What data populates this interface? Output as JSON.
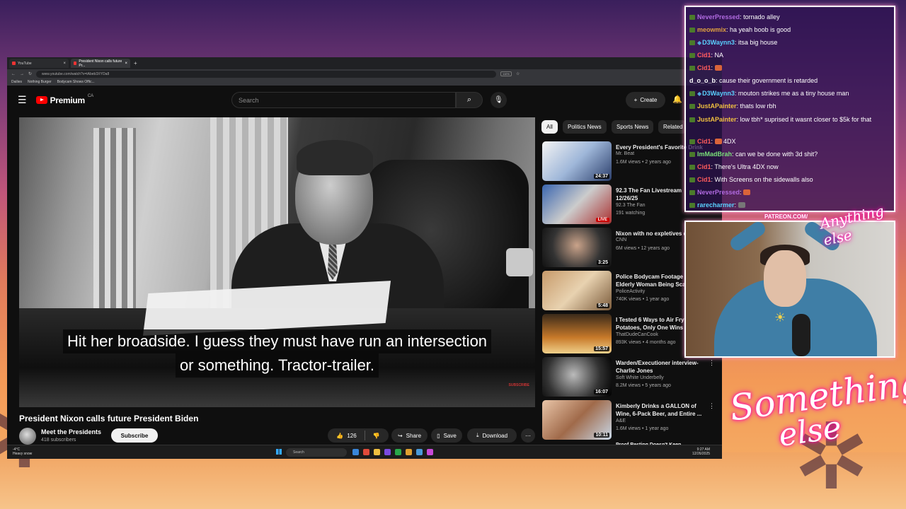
{
  "browser": {
    "tabs": [
      {
        "label": "YouTube"
      },
      {
        "label": "President Nixon calls future Pr..."
      }
    ],
    "url": "www.youtube.com/watch?v=tAbeb3XYOa8",
    "zoom": "110%",
    "bookmarks": [
      "Dailies",
      "Nothing Burger",
      "Bodycam Shows Offic..."
    ]
  },
  "youtube": {
    "logo": "Premium",
    "region": "CA",
    "search_placeholder": "Search",
    "create_label": "Create",
    "caption_line1": "Hit her broadside. I guess they must have run an intersection",
    "caption_line2": "or something. Tractor-trailer.",
    "watermark": "SUBSCRIBE",
    "video_title": "President Nixon calls future President Biden",
    "channel": "Meet the Presidents",
    "subscribers": "418 subscribers",
    "subscribe_label": "Subscribe",
    "likes": "126",
    "share_label": "Share",
    "save_label": "Save",
    "download_label": "Download",
    "chips": [
      "All",
      "Politics News",
      "Sports News",
      "Related"
    ],
    "recommendations": [
      {
        "title": "Every President's Favorite Drink",
        "channel": "Mr. Beat",
        "meta": "1.6M views • 2 years ago",
        "duration": "24:37"
      },
      {
        "title": "92.3 The Fan Livestream 12/26/25",
        "channel": "92.3 The Fan",
        "meta": "191 watching",
        "badge": "LIVE"
      },
      {
        "title": "Nixon with no expletives d...",
        "channel": "CNN",
        "meta": "6M views • 12 years ago",
        "duration": "3:25"
      },
      {
        "title": "Police Bodycam Footage Elderly Woman Being Sca...",
        "channel": "PoliceActivity",
        "meta": "740K views • 1 year ago",
        "duration": "5:48"
      },
      {
        "title": "I Tested 6 Ways to Air Fry Potatoes, Only One Wins",
        "channel": "ThatDudeCanCook",
        "meta": "893K views • 4 months ago",
        "duration": "15:57"
      },
      {
        "title": "Warden/Executioner interview- Charlie Jones",
        "channel": "Soft White Underbelly",
        "meta": "8.2M views • 5 years ago",
        "duration": "16:07"
      },
      {
        "title": "Kimberly Drinks a GALLON of Wine, 6-Pack Beer, and Entire ...",
        "channel": "A&E",
        "meta": "1.6M views • 1 year ago",
        "duration": "10:11"
      }
    ],
    "rec_next": "Proof Resting Doesn't Keep..."
  },
  "taskbar": {
    "weather_temp": "-4°C",
    "weather_desc": "Heavy snow",
    "search": "Search",
    "time": "9:27 AM",
    "date": "12/26/2025"
  },
  "chat": [
    {
      "user": "NeverPressed",
      "color": "#b06ae0",
      "text": "tornado alley"
    },
    {
      "user": "meowmix",
      "color": "#e0a040",
      "text": "ha yeah boob is good"
    },
    {
      "user": "D3Waynn3",
      "color": "#5ad0ff",
      "text": "itsa big house",
      "gem": true
    },
    {
      "user": "Cid1",
      "color": "#ff5c5c",
      "text": "NA"
    },
    {
      "user": "Cid1",
      "color": "#ff5c5c",
      "text": "",
      "emote": true
    },
    {
      "user": "d_o_o_b",
      "color": "#ffffff",
      "text": "cause their government is retarded"
    },
    {
      "user": "D3Waynn3",
      "color": "#5ad0ff",
      "text": "mouton strikes me as a tiny house man",
      "gem": true
    },
    {
      "user": "JustAPainter",
      "color": "#f0c040",
      "text": "thats low rbh"
    },
    {
      "user": "JustAPainter",
      "color": "#f0c040",
      "text": "low tbh* suprised it wasnt closer to $5k for that"
    },
    {
      "user": "Cid1",
      "color": "#ff5c5c",
      "text": "4DX",
      "emote": true
    },
    {
      "user": "ImMadBrah",
      "color": "#7ae07a",
      "text": "can we be done with 3d shit?"
    },
    {
      "user": "Cid1",
      "color": "#ff5c5c",
      "text": "There's Ultra 4DX now"
    },
    {
      "user": "Cid1",
      "color": "#ff5c5c",
      "text": "With Screens on the sidewalls also"
    },
    {
      "user": "NeverPressed",
      "color": "#b06ae0",
      "text": "",
      "emote": true
    },
    {
      "user": "rarecharmer",
      "color": "#5ad0ff",
      "text": "",
      "emote": true
    }
  ],
  "overlay": {
    "patreon": "PATREON.COM/",
    "brand_top": "Anything else",
    "brand_line1": "Something",
    "brand_line2": "else"
  }
}
